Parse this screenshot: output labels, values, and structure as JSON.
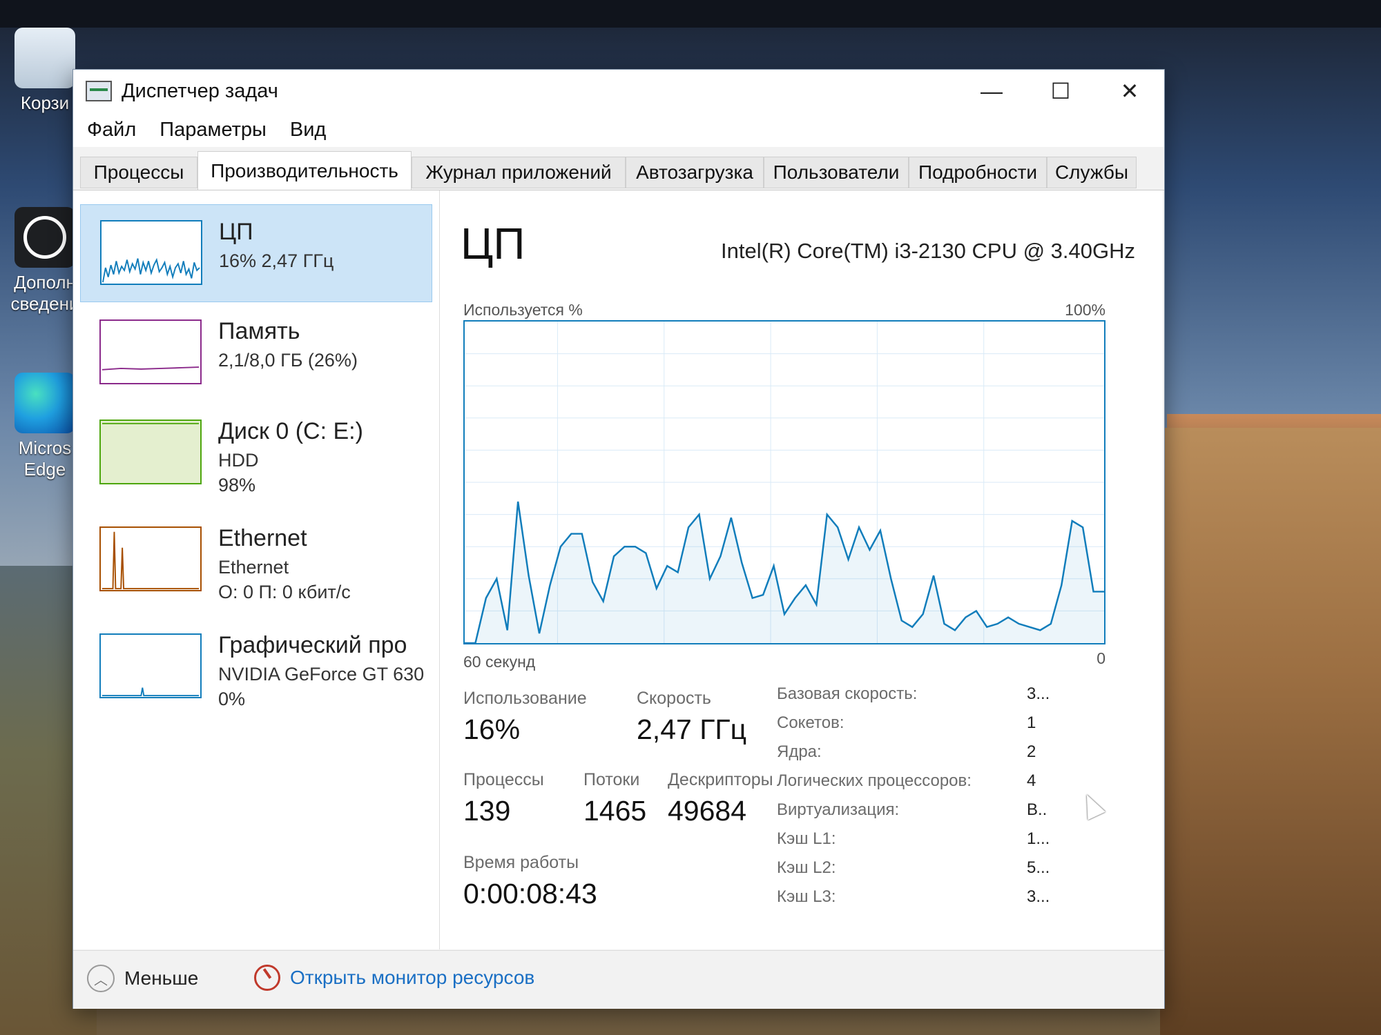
{
  "desktop": {
    "icons": [
      {
        "label": "Корзи",
        "icon": "recycle-bin-icon"
      },
      {
        "label": "Дополн сведени",
        "icon": "info-app-icon"
      },
      {
        "label": "Micros Edge",
        "icon": "edge-icon"
      }
    ]
  },
  "window": {
    "title": "Диспетчер задач",
    "controls": {
      "minimize": "—",
      "maximize": "☐",
      "close": "✕"
    }
  },
  "menu": [
    "Файл",
    "Параметры",
    "Вид"
  ],
  "tabs": [
    "Процессы",
    "Производительность",
    "Журнал приложений",
    "Автозагрузка",
    "Пользователи",
    "Подробности",
    "Службы"
  ],
  "active_tab": "Производительность",
  "sidebar": {
    "items": [
      {
        "name": "ЦП",
        "line1": "16% 2,47 ГГц",
        "line2": "",
        "line3": "",
        "color": "#117dbb",
        "selected": true
      },
      {
        "name": "Память",
        "line1": "2,1/8,0 ГБ (26%)",
        "line2": "",
        "line3": "",
        "color": "#8b2a8b",
        "selected": false
      },
      {
        "name": "Диск 0 (C: E:)",
        "line1": "HDD",
        "line2": "98%",
        "line3": "",
        "color": "#4da60c",
        "selected": false
      },
      {
        "name": "Ethernet",
        "line1": "Ethernet",
        "line2": "О: 0 П: 0 кбит/с",
        "line3": "",
        "color": "#a74f01",
        "selected": false
      },
      {
        "name": "Графический про",
        "line1": "NVIDIA GeForce GT 630",
        "line2": "0%",
        "line3": "",
        "color": "#117dbb",
        "selected": false
      }
    ]
  },
  "cpu": {
    "title": "ЦП",
    "model": "Intel(R) Core(TM) i3-2130 CPU @ 3.40GHz",
    "graph_label_left": "Используется %",
    "graph_label_right": "100%",
    "graph_time_label": "60 секунд",
    "graph_zero_label": "0",
    "stats": {
      "usage_label": "Использование",
      "usage_value": "16%",
      "speed_label": "Скорость",
      "speed_value": "2,47 ГГц",
      "processes_label": "Процессы",
      "processes_value": "139",
      "threads_label": "Потоки",
      "threads_value": "1465",
      "handles_label": "Дескрипторы",
      "handles_value": "49684",
      "uptime_label": "Время работы",
      "uptime_value": "0:00:08:43"
    },
    "specs": [
      {
        "label": "Базовая скорость:",
        "value": "3..."
      },
      {
        "label": "Сокетов:",
        "value": "1"
      },
      {
        "label": "Ядра:",
        "value": "2"
      },
      {
        "label": "Логических процессоров:",
        "value": "4"
      },
      {
        "label": "Виртуализация:",
        "value": "В.."
      },
      {
        "label": "Кэш L1:",
        "value": "1..."
      },
      {
        "label": "Кэш L2:",
        "value": "5..."
      },
      {
        "label": "Кэш L3:",
        "value": "3..."
      }
    ]
  },
  "chart_data": {
    "type": "line",
    "xlabel": "60 секунд",
    "ylabel": "Используется %",
    "ylim": [
      0,
      100
    ],
    "grid": true,
    "series": [
      {
        "values": [
          0,
          0,
          14,
          20,
          4,
          44,
          21,
          3,
          18,
          30,
          34,
          34,
          19,
          13,
          27,
          30,
          30,
          28,
          17,
          24,
          22,
          36,
          40,
          20,
          27,
          39,
          25,
          14,
          15,
          24,
          9,
          14,
          18,
          12,
          40,
          36,
          26,
          36,
          29,
          35,
          20,
          7,
          5,
          9,
          21,
          6,
          4,
          8,
          10,
          5,
          6,
          8,
          6,
          5,
          4,
          6,
          18,
          38,
          36,
          16,
          16
        ]
      }
    ]
  },
  "footer": {
    "fewer_label": "Меньше",
    "monitor_label": "Открыть монитор ресурсов"
  }
}
